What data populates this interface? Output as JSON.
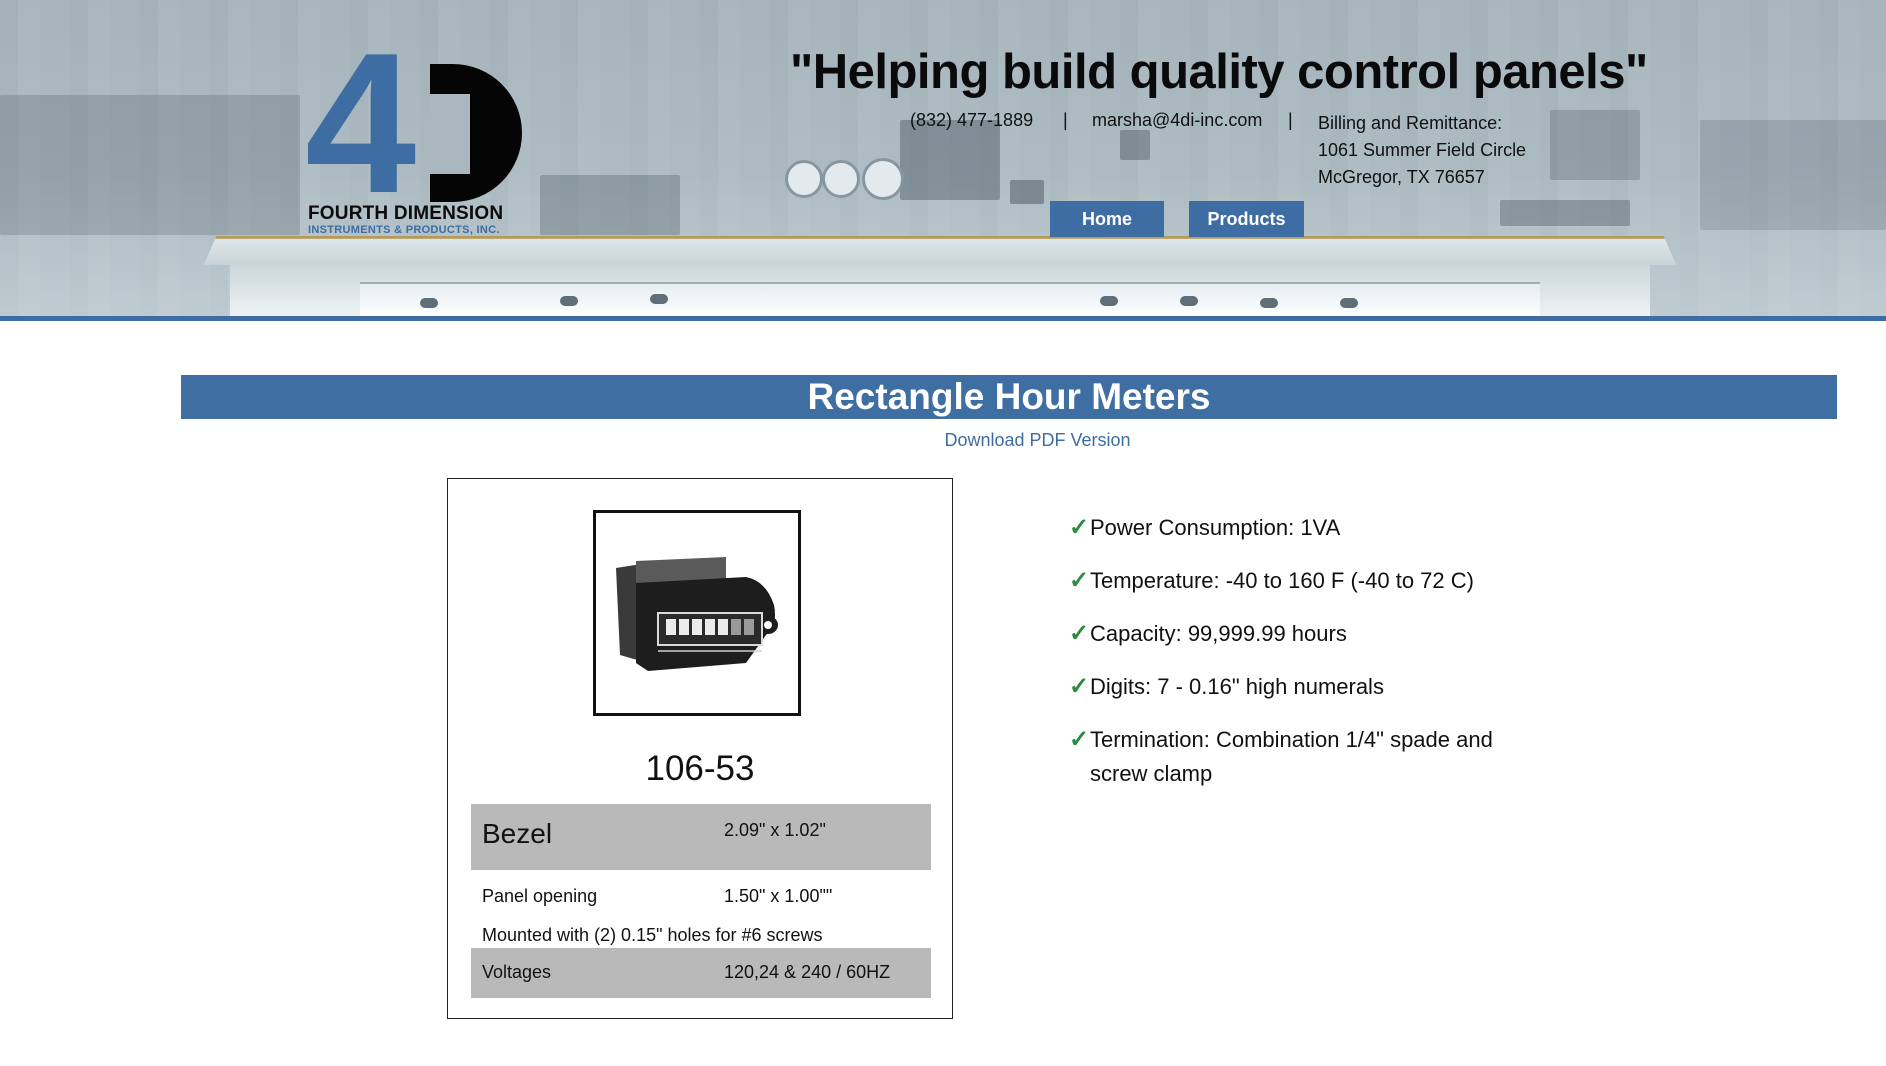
{
  "header": {
    "logo": {
      "brand_name": "FOURTH DIMENSION",
      "brand_sub": "INSTRUMENTS & PRODUCTS, INC.",
      "logo_mark": "4D"
    },
    "tagline": "\"Helping build quality control panels\"",
    "contact": {
      "phone": "(832) 477-1889",
      "separator": "|",
      "email": "marsha@4di-inc.com",
      "billing_line1": "Billing and Remittance:",
      "billing_line2": "1061 Summer Field Circle",
      "billing_line3": "McGregor, TX 76657"
    },
    "nav": {
      "home": "Home",
      "products": "Products"
    }
  },
  "page": {
    "title": "Rectangle Hour Meters",
    "pdf_link": "Download PDF Version"
  },
  "product": {
    "model": "106-53",
    "image_icon": "hour-meter-photo",
    "specs": {
      "bezel_label": "Bezel",
      "bezel_value": "2.09\" x 1.02\"",
      "panel_label": "Panel opening",
      "panel_value": "1.50\" x 1.00\"\"",
      "mount_text": "Mounted with (2) 0.15\" holes for #6 screws",
      "voltage_label": "Voltages",
      "voltage_value": "120,24 & 240 / 60HZ"
    }
  },
  "features": [
    "Power Consumption: 1VA",
    "Temperature: -40 to 160 F (-40 to 72 C)",
    "Capacity: 99,999.99 hours",
    "Digits: 7 - 0.16\" high numerals",
    "Termination: Combination 1/4\" spade and screw clamp"
  ],
  "colors": {
    "brand_blue": "#3d6da3",
    "check_green": "#2e8b3e",
    "spec_shade": "#b9b9b9"
  }
}
